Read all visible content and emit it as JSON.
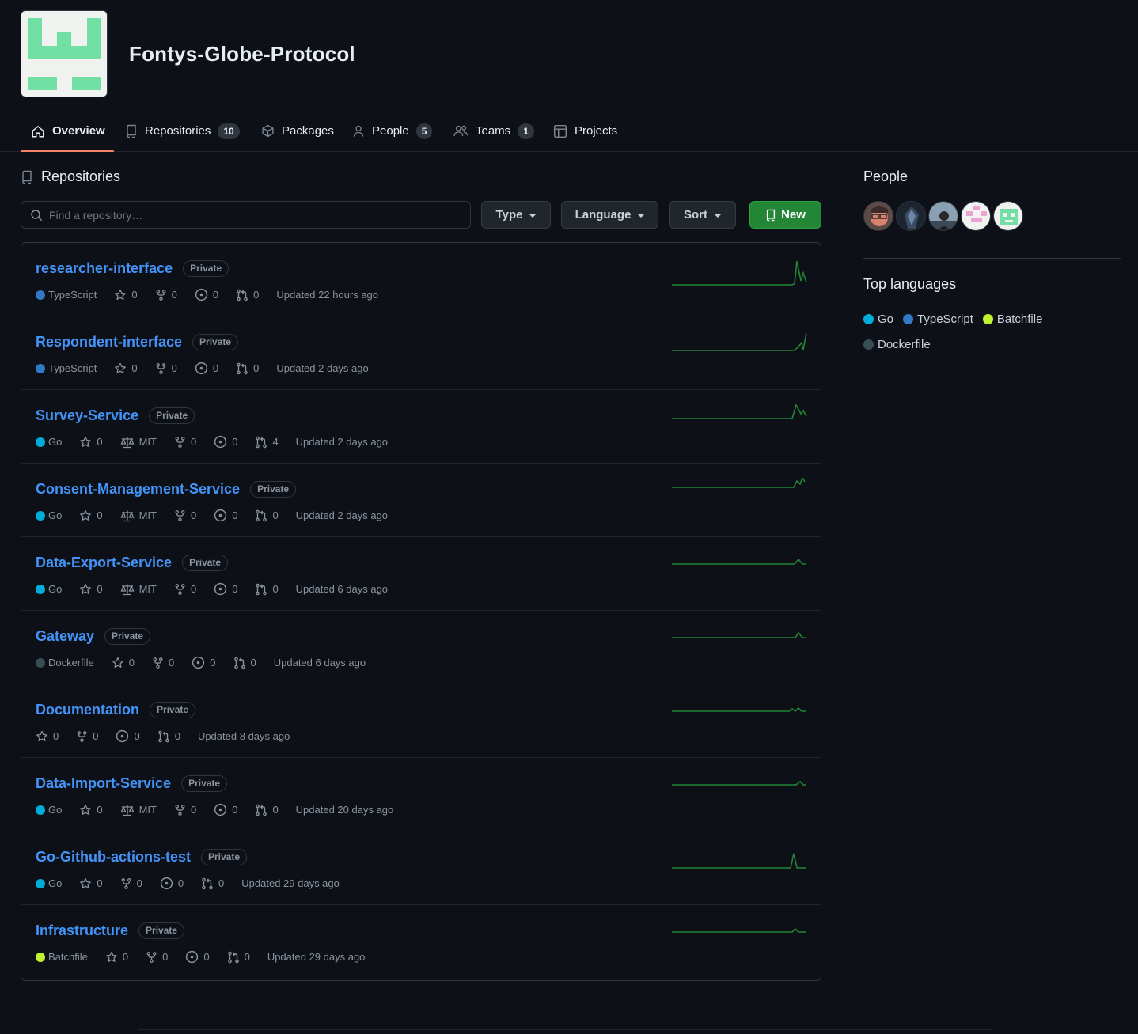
{
  "org": {
    "name": "Fontys-Globe-Protocol"
  },
  "tabs": [
    {
      "label": "Overview",
      "icon": "home-icon"
    },
    {
      "label": "Repositories",
      "count": "10",
      "icon": "repo-icon"
    },
    {
      "label": "Packages",
      "icon": "package-icon"
    },
    {
      "label": "People",
      "count": "5",
      "icon": "person-icon"
    },
    {
      "label": "Teams",
      "count": "1",
      "icon": "people-icon"
    },
    {
      "label": "Projects",
      "icon": "table-icon"
    }
  ],
  "repos_section": {
    "title": "Repositories",
    "search_placeholder": "Find a repository…",
    "type_label": "Type",
    "language_label": "Language",
    "sort_label": "Sort",
    "new_label": "New"
  },
  "repositories": [
    {
      "name": "researcher-interface",
      "visibility": "Private",
      "language": "TypeScript",
      "lang_color": "#3178c6",
      "stars": "0",
      "license": "",
      "forks": "0",
      "issues": "0",
      "prs": "0",
      "updated": "Updated 22 hours ago"
    },
    {
      "name": "Respondent-interface",
      "visibility": "Private",
      "language": "TypeScript",
      "lang_color": "#3178c6",
      "stars": "0",
      "license": "",
      "forks": "0",
      "issues": "0",
      "prs": "0",
      "updated": "Updated 2 days ago"
    },
    {
      "name": "Survey-Service",
      "visibility": "Private",
      "language": "Go",
      "lang_color": "#00ADD8",
      "stars": "0",
      "license": "MIT",
      "forks": "0",
      "issues": "0",
      "prs": "4",
      "updated": "Updated 2 days ago"
    },
    {
      "name": "Consent-Management-Service",
      "visibility": "Private",
      "language": "Go",
      "lang_color": "#00ADD8",
      "stars": "0",
      "license": "MIT",
      "forks": "0",
      "issues": "0",
      "prs": "0",
      "updated": "Updated 2 days ago"
    },
    {
      "name": "Data-Export-Service",
      "visibility": "Private",
      "language": "Go",
      "lang_color": "#00ADD8",
      "stars": "0",
      "license": "MIT",
      "forks": "0",
      "issues": "0",
      "prs": "0",
      "updated": "Updated 6 days ago"
    },
    {
      "name": "Gateway",
      "visibility": "Private",
      "language": "Dockerfile",
      "lang_color": "#384d54",
      "stars": "0",
      "license": "",
      "forks": "0",
      "issues": "0",
      "prs": "0",
      "updated": "Updated 6 days ago"
    },
    {
      "name": "Documentation",
      "visibility": "Private",
      "language": "",
      "lang_color": "",
      "stars": "0",
      "license": "",
      "forks": "0",
      "issues": "0",
      "prs": "0",
      "updated": "Updated 8 days ago"
    },
    {
      "name": "Data-Import-Service",
      "visibility": "Private",
      "language": "Go",
      "lang_color": "#00ADD8",
      "stars": "0",
      "license": "MIT",
      "forks": "0",
      "issues": "0",
      "prs": "0",
      "updated": "Updated 20 days ago"
    },
    {
      "name": "Go-Github-actions-test",
      "visibility": "Private",
      "language": "Go",
      "lang_color": "#00ADD8",
      "stars": "0",
      "license": "",
      "forks": "0",
      "issues": "0",
      "prs": "0",
      "updated": "Updated 29 days ago"
    },
    {
      "name": "Infrastructure",
      "visibility": "Private",
      "language": "Batchfile",
      "lang_color": "#C1F12E",
      "stars": "0",
      "license": "",
      "forks": "0",
      "issues": "0",
      "prs": "0",
      "updated": "Updated 29 days ago"
    }
  ],
  "sidebar": {
    "people_title": "People",
    "people": [
      "member-1",
      "member-2",
      "member-3",
      "member-4",
      "member-5"
    ],
    "top_languages_title": "Top languages",
    "top_languages": [
      {
        "name": "Go",
        "color": "#00ADD8"
      },
      {
        "name": "TypeScript",
        "color": "#3178c6"
      },
      {
        "name": "Batchfile",
        "color": "#C1F12E"
      },
      {
        "name": "Dockerfile",
        "color": "#384d54"
      }
    ]
  },
  "colors": {
    "accent": "#4493f8",
    "tab_underline": "#f78166",
    "new_button": "#238636",
    "sparkline": "#238636"
  }
}
